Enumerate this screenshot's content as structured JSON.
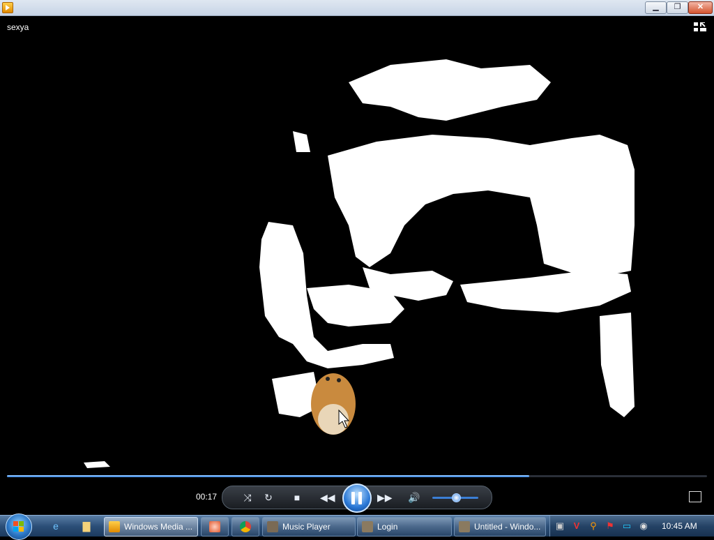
{
  "window": {
    "title_icon": "media-player-icon",
    "min_label": "▁",
    "max_label": "❐",
    "close_label": "✕"
  },
  "video": {
    "title": "sexya"
  },
  "player": {
    "elapsed": "00:17",
    "progress_fraction": 0.746,
    "volume_fraction": 0.5,
    "accent": "#2c7de0"
  },
  "taskbar": {
    "quick_launch": [
      "internet-explorer-icon",
      "folder-icon"
    ],
    "tasks": [
      {
        "label": "Windows Media ...",
        "icon": "windows-media-player-icon",
        "active": true
      },
      {
        "label": "",
        "icon": "app-icon"
      },
      {
        "label": "",
        "icon": "chrome-icon"
      },
      {
        "label": "Music Player",
        "icon": "music-player-icon"
      },
      {
        "label": "Login",
        "icon": "login-icon"
      },
      {
        "label": "Untitled - Windo...",
        "icon": "window-icon"
      }
    ],
    "clock": "10:45 AM"
  }
}
